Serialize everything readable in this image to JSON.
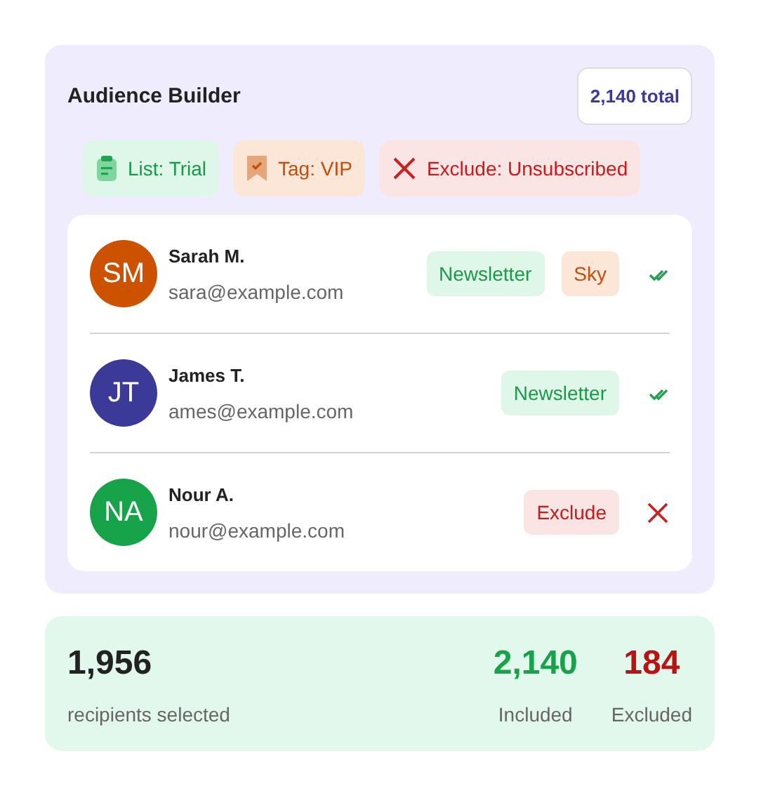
{
  "panel": {
    "title": "Audience Builder",
    "total": "2,140 total"
  },
  "filters": [
    {
      "kind": "list",
      "label": "List: Trial"
    },
    {
      "kind": "tag",
      "label": "Tag: VIP"
    },
    {
      "kind": "exclude",
      "label": "Exclude: Unsubscribed"
    }
  ],
  "contacts": [
    {
      "initials": "SM",
      "color": "#cc5200",
      "name": "Sarah M.",
      "email": "sara@example.com",
      "tags": [
        {
          "kind": "include",
          "label": "Newsletter"
        },
        {
          "kind": "tag",
          "label": "Sky"
        }
      ],
      "excluded": false
    },
    {
      "initials": "JT",
      "color": "#3b3a98",
      "name": "James T.",
      "email": "ames@example.com",
      "tags": [
        {
          "kind": "include",
          "label": "Newsletter"
        }
      ],
      "excluded": false
    },
    {
      "initials": "NA",
      "color": "#17a34a",
      "name": "Nour A.",
      "email": "nour@example.com",
      "tags": [
        {
          "kind": "exclude",
          "label": "Exclude"
        }
      ],
      "excluded": true
    }
  ],
  "summary": {
    "selected": "1,956",
    "selected_label": "recipients selected",
    "stats": [
      {
        "kind": "included",
        "value": "2,140",
        "label": "Included"
      },
      {
        "kind": "excluded",
        "value": "184",
        "label": "Excluded"
      }
    ]
  }
}
